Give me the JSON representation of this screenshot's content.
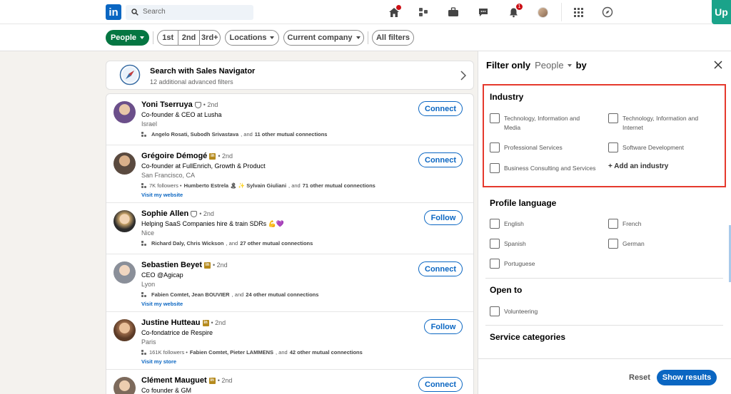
{
  "nav": {
    "logo_text": "in",
    "search_placeholder": "Search",
    "notifications_badge_home": "",
    "notifications_badge": "1",
    "up_label": "Up",
    "icons": [
      "home-icon",
      "my-network-icon",
      "jobs-icon",
      "messaging-icon",
      "notifications-icon",
      "me-avatar",
      "apps-grid-icon",
      "compass-icon"
    ]
  },
  "filters": {
    "people": "People",
    "first": "1st",
    "second": "2nd",
    "third": "3rd+",
    "locations": "Locations",
    "current_company": "Current company",
    "all_filters": "All filters"
  },
  "sales_nav": {
    "title": "Search with Sales Navigator",
    "subtitle": "12 additional advanced filters"
  },
  "results": [
    {
      "name": "Yoni Tserruya",
      "badge": "shield",
      "degree": "• 2nd",
      "title": "Co-founder & CEO at Lusha",
      "location": "Israel",
      "mutual_pre": "",
      "mutual_names": "Angelo Rosati, Subodh Srivastava",
      "mutual_post": ", and ",
      "mutual_count": "11 other mutual connections",
      "website": "",
      "action": "Connect",
      "avatar_color": "#6b4f8a"
    },
    {
      "name": "Grégoire Démogé",
      "badge": "in",
      "degree": "• 2nd",
      "title": "Co-founder at FullEnrich, Growth & Product",
      "location": "San Francisco, CA",
      "mutual_pre": "7K followers • ",
      "mutual_names": "Humberto Estrela 🏝 ✨ Sylvain Giuliani",
      "mutual_post": ", and ",
      "mutual_count": "71 other mutual connections",
      "website": "Visit my website",
      "action": "Connect",
      "avatar_color": "#5a4a3f"
    },
    {
      "name": "Sophie Allen",
      "badge": "shield",
      "degree": "• 2nd",
      "title": "Helping SaaS Companies hire & train SDRs 💪💜",
      "location": "Nice",
      "mutual_pre": "",
      "mutual_names": "Richard Daly, Chris Wickson",
      "mutual_post": ", and ",
      "mutual_count": "27 other mutual connections",
      "website": "",
      "action": "Follow",
      "avatar_color": "#c9a46a"
    },
    {
      "name": "Sebastien Beyet",
      "badge": "in",
      "degree": "• 2nd",
      "title": "CEO @Agicap",
      "location": "Lyon",
      "mutual_pre": "",
      "mutual_names": "Fabien Comtet, Jean BOUVIER",
      "mutual_post": ", and ",
      "mutual_count": "24 other mutual connections",
      "website": "Visit my website",
      "action": "Connect",
      "avatar_color": "#8a8f99"
    },
    {
      "name": "Justine Hutteau",
      "badge": "in",
      "degree": "• 2nd",
      "title": "Co-fondatrice de Respire",
      "location": "Paris",
      "mutual_pre": "161K followers • ",
      "mutual_names": "Fabien Comtet, Pieter LAMMENS",
      "mutual_post": ", and ",
      "mutual_count": "42 other mutual connections",
      "website": "Visit my store",
      "action": "Follow",
      "avatar_color": "#9b6b4a"
    },
    {
      "name": "Clément Mauguet",
      "badge": "in",
      "degree": "• 2nd",
      "title": "Co founder & GM",
      "location": "",
      "mutual_pre": "",
      "mutual_names": "",
      "mutual_post": "",
      "mutual_count": "",
      "website": "",
      "action": "Connect",
      "avatar_color": "#7d6a5c"
    }
  ],
  "panel": {
    "filter_only": "Filter only",
    "selected": "People",
    "by": "by",
    "industry_title": "Industry",
    "industry_options": [
      "Technology, Information and Media",
      "Technology, Information and Internet",
      "Professional Services",
      "Software Development",
      "Business Consulting and Services"
    ],
    "add_industry": "Add an industry",
    "language_title": "Profile language",
    "languages": [
      "English",
      "French",
      "Spanish",
      "German",
      "Portuguese"
    ],
    "open_to_title": "Open to",
    "open_to": [
      "Volunteering"
    ],
    "service_title": "Service categories",
    "reset": "Reset",
    "show_results": "Show results"
  },
  "colors": {
    "accent": "#0a66c2",
    "people_pill": "#057642",
    "highlight": "#e5392d",
    "up_brand": "#1aa38a"
  }
}
